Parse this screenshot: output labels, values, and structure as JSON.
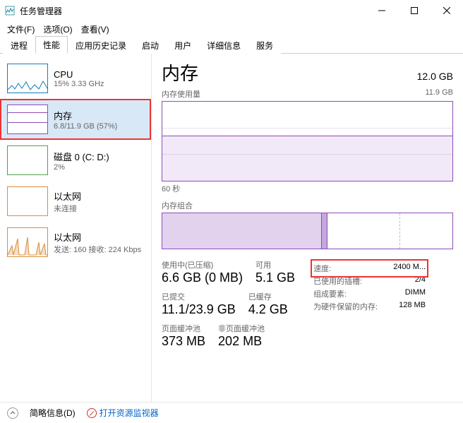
{
  "window": {
    "title": "任务管理器"
  },
  "menu": {
    "file": "文件(F)",
    "options": "选项(O)",
    "view": "查看(V)"
  },
  "tabs": {
    "processes": "进程",
    "performance": "性能",
    "app_history": "应用历史记录",
    "startup": "启动",
    "users": "用户",
    "details": "详细信息",
    "services": "服务"
  },
  "sidebar": [
    {
      "title": "CPU",
      "sub": "15% 3.33 GHz",
      "type": "cpu"
    },
    {
      "title": "内存",
      "sub": "6.8/11.9 GB (57%)",
      "type": "mem",
      "selected": true,
      "highlighted": true
    },
    {
      "title": "磁盘 0 (C: D:)",
      "sub": "2%",
      "type": "disk"
    },
    {
      "title": "以太网",
      "sub": "未连接",
      "type": "net"
    },
    {
      "title": "以太网",
      "sub": "发送: 160 接收: 224 Kbps",
      "type": "net2"
    }
  ],
  "main": {
    "title": "内存",
    "total": "12.0 GB",
    "usage_label": "内存使用量",
    "usage_max": "11.9 GB",
    "time_label": "60 秒",
    "comp_label": "内存组合",
    "stats": {
      "in_use_label": "使用中(已压缩)",
      "in_use_value": "6.6 GB (0 MB)",
      "avail_label": "可用",
      "avail_value": "5.1 GB",
      "commit_label": "已提交",
      "commit_value": "11.1/23.9 GB",
      "cached_label": "已缓存",
      "cached_value": "4.2 GB",
      "paged_label": "页面缓冲池",
      "paged_value": "373 MB",
      "nonpaged_label": "非页面缓冲池",
      "nonpaged_value": "202 MB"
    },
    "details": [
      {
        "label": "速度:",
        "value": "2400 M..."
      },
      {
        "label": "已使用的插槽:",
        "value": "2/4"
      },
      {
        "label": "组成要素:",
        "value": "DIMM"
      },
      {
        "label": "为硬件保留的内存:",
        "value": "128 MB"
      }
    ]
  },
  "footer": {
    "fewer": "简略信息(D)",
    "resmon": "打开资源监视器"
  }
}
